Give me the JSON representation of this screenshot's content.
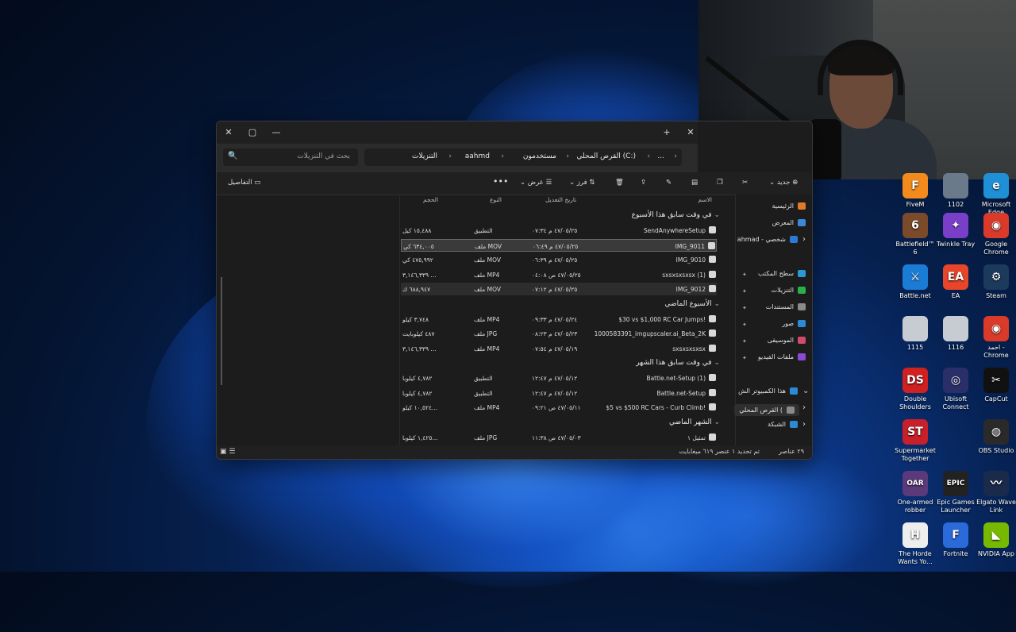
{
  "desktop": {
    "icons": [
      {
        "label": "FiveM",
        "color": "#f28a1c",
        "glyph": "F"
      },
      {
        "label": "1102",
        "color": "#6a7a8a",
        "glyph": ""
      },
      {
        "label": "Microsoft Edge",
        "color": "#1f8fd6",
        "glyph": "e"
      },
      {
        "label": "Battlefield™ 6",
        "color": "#7a4a2a",
        "glyph": "6"
      },
      {
        "label": "Twinkle Tray",
        "color": "#7a3fc9",
        "glyph": "✦"
      },
      {
        "label": "Google Chrome",
        "color": "#d93a2a",
        "glyph": "◉"
      },
      {
        "label": "Battle.net",
        "color": "#1b7cd6",
        "glyph": "⚔"
      },
      {
        "label": "EA",
        "color": "#e8452a",
        "glyph": "EA"
      },
      {
        "label": "Steam",
        "color": "#1b3a5c",
        "glyph": "⚙"
      },
      {
        "label": "1115",
        "color": "#c7ccd2",
        "glyph": ""
      },
      {
        "label": "1116",
        "color": "#c7ccd2",
        "glyph": ""
      },
      {
        "label": "احمد - Chrome",
        "color": "#d93a2a",
        "glyph": "◉"
      },
      {
        "label": "Double Shoulders",
        "color": "#d02020",
        "glyph": "DS"
      },
      {
        "label": "Ubisoft Connect",
        "color": "#2a2f6a",
        "glyph": "◎"
      },
      {
        "label": "CapCut",
        "color": "#111111",
        "glyph": "✂"
      },
      {
        "label": "Supermarket Together",
        "color": "#c8202a",
        "glyph": "ST"
      },
      {
        "label": "OBS Studio",
        "color": "#2a2a2a",
        "glyph": "◍"
      },
      {
        "label": "One-armed robber",
        "color": "#5a3a7a",
        "glyph": "OAR"
      },
      {
        "label": "Epic Games Launcher",
        "color": "#222222",
        "glyph": "EPIC"
      },
      {
        "label": "Elgato Wave Link",
        "color": "#1a2a4a",
        "glyph": "〰"
      },
      {
        "label": "The Horde Wants Yo...",
        "color": "#eeeeee",
        "glyph": "H"
      },
      {
        "label": "Fortnite",
        "color": "#2a6ad9",
        "glyph": "F"
      },
      {
        "label": "NVIDIA App",
        "color": "#76b900",
        "glyph": "◣"
      }
    ]
  },
  "explorer": {
    "window_controls": {
      "close": "✕",
      "maximize": "▢",
      "minimize": "—",
      "tab_close": "✕",
      "new_tab": "+"
    },
    "search": {
      "placeholder": "بحث في التنزيلات",
      "icon": "🔍"
    },
    "breadcrumb": [
      "القرص المحلي (C:)",
      "مستخدمون",
      "aahmd",
      "التنزيلات"
    ],
    "breadcrumb_more": "...",
    "toolbar": {
      "new": "جديد",
      "sort": "فرز",
      "view": "عرض",
      "more": "•••",
      "details": "التفاصيل"
    },
    "columns": {
      "name": "الاسم",
      "date": "تاريخ التعديل",
      "type": "النوع",
      "size": "الحجم"
    },
    "sidebar": {
      "items": [
        {
          "label": "الرئيسية",
          "color": "#e07a2a"
        },
        {
          "label": "المعرض",
          "color": "#3a8ad6"
        },
        {
          "label": "ahmad - شخصي",
          "color": "#2a7ad6"
        },
        {
          "label": "سطح المكتب",
          "color": "#2a9ad6"
        },
        {
          "label": "التنزيلات",
          "color": "#2ab04a"
        },
        {
          "label": "المستندات",
          "color": "#8a8a8a"
        },
        {
          "label": "صور",
          "color": "#2a8ad6"
        },
        {
          "label": "الموسيقى",
          "color": "#d04a6a"
        },
        {
          "label": "ملفات الفيديو",
          "color": "#8a4ad6"
        },
        {
          "label": "هذا الكمبيوتر الش",
          "color": "#2a8ad6"
        },
        {
          "label": "القرص المحلي (",
          "color": "#8a8a8a"
        },
        {
          "label": "الشبكة",
          "color": "#2a8ad6"
        }
      ]
    },
    "groups": [
      {
        "title": "في وقت سابق هذا الأسبوع",
        "rows": [
          {
            "name": "SendAnywhereSetup",
            "date": "٤٧/٠٥/٢٥ م ٠٧:٣٤",
            "type": "التطبيق",
            "size": "١٥,٤٨٨ كيل"
          },
          {
            "name": "IMG_9011",
            "date": "٤٧/٠٥/٢٥ م ٠٦:٤٩",
            "type": "ملف MOV",
            "size": "٦٣٤,٠٠٥ كي"
          },
          {
            "name": "IMG_9010",
            "date": "٤٧/٠٥/٢٥ م ٠٦:٣٩",
            "type": "ملف MOV",
            "size": "٤٧٥,٩٩٢ كي"
          },
          {
            "name": "sxsxsxsxsx (1)",
            "date": "٤٧/٠٥/٢٥ ص ٠٤:٠٨",
            "type": "ملف MP4",
            "size": "٣,١٤٦,٣٣٩ ..."
          },
          {
            "name": "IMG_9012",
            "date": "٤٧/٠٥/٢٥ م ٠٧:١٢",
            "type": "ملف MOV",
            "size": "٦٨٨,٩٤٧ ك"
          }
        ]
      },
      {
        "title": "الأسبوع الماضي",
        "rows": [
          {
            "name": "$30 vs $1,000 RC Car Jumps!",
            "date": "٤٧/٠٥/٢٤ م ٠٩:٣٣",
            "type": "ملف MP4",
            "size": "٣,٧٤٨ كيلو"
          },
          {
            "name": "1000583391_imgupscaler.ai_Beta_2K",
            "date": "٤٧/٠٥/٢٣ م ٠٨:٢٣",
            "type": "ملف JPG",
            "size": "٤٨٧ كيلوبايت"
          },
          {
            "name": "sxsxsxsxsx",
            "date": "٤٧/٠٥/١٩ م ٠٧:٥٤",
            "type": "ملف MP4",
            "size": "٣,١٤٦,٣٣٩ ..."
          }
        ]
      },
      {
        "title": "في وقت سابق هذا الشهر",
        "rows": [
          {
            "name": "Battle.net-Setup (1)",
            "date": "٤٧/٠٥/١٢ م ١٢:٤٧",
            "type": "التطبيق",
            "size": "٤,٧٨٢ كيلوبا"
          },
          {
            "name": "Battle.net-Setup",
            "date": "٤٧/٠٥/١٢ م ١٢:٤٧",
            "type": "التطبيق",
            "size": "٤,٧٨٢ كيلوبا"
          },
          {
            "name": "$5 vs $500 RC Cars - Curb Climb!",
            "date": "٤٧/٠٥/١١ ص ٠٩:٢١",
            "type": "ملف MP4",
            "size": "١٠,٥٢٤ كيلو..."
          }
        ]
      },
      {
        "title": "الشهر الماضي",
        "rows": [
          {
            "name": "تمثيل ١",
            "date": "٤٧/٠٥/٠٣ ص ١١:٣٨",
            "type": "ملف JPG",
            "size": "١,٤٢٥ كيلوبا..."
          }
        ]
      }
    ],
    "status": {
      "count": "٢٩ عناصر",
      "selection": "تم تحديد ١ عنصر ٦١٩ ميغابايت"
    }
  }
}
